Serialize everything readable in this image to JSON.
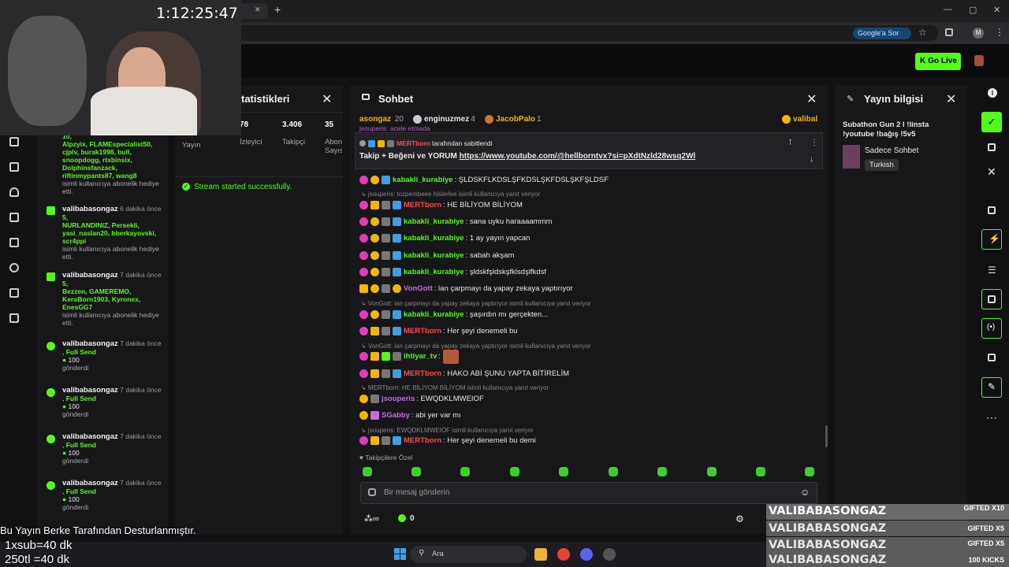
{
  "browser": {
    "tab_title": "ıl Bot",
    "new_tab": "+",
    "google_pill": "Google'a Sor",
    "avatar_letter": "M"
  },
  "timer": "1:12:25:47",
  "header": {
    "go_live": "Go Live"
  },
  "feed": [
    {
      "top_text": "10,",
      "names": "Alpzyix, FLAMEspecialist50, cjplv, burak1998, bull, snoopdogg, rtxbinsix, Dolphinsfanzack, riftinmypants87, wang8",
      "tail": "isimli kullanıcıya abonelik hediye etti."
    },
    {
      "user": "valibabasongaz",
      "time": "6 dakika önce",
      "count": "5,",
      "names": "NURLANDINIZ, Persekli, yasi_naslan20, bberkayovski, scr4ppi",
      "tail": "isimli kullanıcıya abonelik hediye etti."
    },
    {
      "user": "valibabasongaz",
      "time": "7 dakika önce",
      "count": "5,",
      "names": "Bezzen, GAMEREMO, KeroBorn1903, Kyronex, EnesGG7",
      "tail": "isimli kullanıcıya abonelik hediye etti."
    },
    {
      "user": "valibabasongaz",
      "time": "7 dakika önce",
      "sub": "Full Send",
      "amount": "100",
      "sent": "gönderdi"
    },
    {
      "user": "valibabasongaz",
      "time": "7 dakika önce",
      "sub": "Full Send",
      "amount": "100",
      "sent": "gönderdi"
    },
    {
      "user": "valibabasongaz",
      "time": "7 dakika önce",
      "sub": "Full Send",
      "amount": "100",
      "sent": "gönderdi"
    },
    {
      "user": "valibabasongaz",
      "time": "7 dakika önce",
      "sub": "Full Send",
      "amount": "100",
      "sent": "gönderdi"
    }
  ],
  "stats": {
    "title": "tatistikleri",
    "cols": [
      {
        "value": "",
        "label": "Yayın"
      },
      {
        "value": "78",
        "label": "İzleyici"
      },
      {
        "value": "3.406",
        "label": "Takipçi"
      },
      {
        "value": "35",
        "label": "Abon Sayıs"
      }
    ],
    "success": "Stream started successfully."
  },
  "chat": {
    "title": "Sohbet",
    "top_gifters": [
      {
        "name": "asongaz",
        "count": "20"
      },
      {
        "rank": "2",
        "name": "enginuzmez",
        "count": "4"
      },
      {
        "rank": "3",
        "name": "JacobPalo",
        "count": "1"
      },
      {
        "rank": "1",
        "name": "valibal"
      }
    ],
    "partial_line": "jsouperis: acele etmada",
    "pinned_by": "MERTborn",
    "pinned_label": "tarafından sabitlendi",
    "pinned_text": "Takip + Beğeni ve YORUM ",
    "pinned_link": "https://www.youtube.com/@hellborntvx?si=pXdtNzld28wsq2Wl",
    "messages": [
      {
        "user": "kabakli_kurabiye",
        "color": "#53fc18",
        "text": ": ŞLDSKFLKDSLŞFKDSLŞKFDSLŞKFŞLDSF",
        "badges": [
          "b-pink",
          "b-gold",
          "b-blue"
        ]
      },
      {
        "reply": "jsouperis: tozpembeee hislerlee isimli kullanıcıya yanıt veriyor"
      },
      {
        "user": "MERTborn",
        "color": "#ff4b4b",
        "text": ": HE BİLİYOM BİLİYOM",
        "badges": [
          "b-pink",
          "b-crown",
          "b-grey",
          "b-blue"
        ]
      },
      {
        "user": "kabakli_kurabiye",
        "color": "#53fc18",
        "text": ": sana uyku haraaaammm",
        "badges": [
          "b-pink",
          "b-gold",
          "b-grey",
          "b-blue"
        ]
      },
      {
        "user": "kabakli_kurabiye",
        "color": "#53fc18",
        "text": ": 1 ay yayın yapcan",
        "badges": [
          "b-pink",
          "b-gold",
          "b-grey",
          "b-blue"
        ]
      },
      {
        "user": "kabakli_kurabiye",
        "color": "#53fc18",
        "text": ": sabah akşam",
        "badges": [
          "b-pink",
          "b-gold",
          "b-grey",
          "b-blue"
        ]
      },
      {
        "user": "kabakli_kurabiye",
        "color": "#53fc18",
        "text": ": şldskfşldskşfklsdşlfkdsf",
        "badges": [
          "b-pink",
          "b-gold",
          "b-grey",
          "b-blue"
        ]
      },
      {
        "user": "VonGott",
        "color": "#c66be0",
        "text": ": lan çarpmayı da yapay zekaya yaptırıyor",
        "badges": [
          "b-crown",
          "b-gold",
          "b-grey",
          "b-gold"
        ]
      },
      {
        "reply": "VonGott: lan çarpmayı da yapay zekaya yaptırıyor isimli kullanıcıya yanıt veriyor"
      },
      {
        "user": "kabakli_kurabiye",
        "color": "#53fc18",
        "text": ": şaşırdın mı gerçekten...",
        "badges": [
          "b-pink",
          "b-gold",
          "b-grey",
          "b-blue"
        ]
      },
      {
        "user": "MERTborn",
        "color": "#ff4b4b",
        "text": ": Her şeyi denemeli bu",
        "badges": [
          "b-pink",
          "b-crown",
          "b-grey",
          "b-blue"
        ]
      },
      {
        "reply": "VonGott: lan çarpmayı da yapay zekaya yaptırıyor isimli kullanıcıya yanıt veriyor"
      },
      {
        "user": "ihtiyar_tv",
        "color": "#53fc18",
        "text": ":",
        "badges": [
          "b-pink",
          "b-crown",
          "b-green",
          "b-grey"
        ]
      },
      {
        "user": "MERTborn",
        "color": "#ff4b4b",
        "text": ": HAKO ABİ ŞUNU YAPTA BİTİRELİM",
        "badges": [
          "b-pink",
          "b-crown",
          "b-grey",
          "b-blue"
        ]
      },
      {
        "reply": "MERTborn: HE BİLİYOM BİLİYOM isimli kullanıcıya yanıt veriyor"
      },
      {
        "user": "jsouperis",
        "color": "#c66be0",
        "text": ": EWQDKLMWEIOF",
        "badges": [
          "b-gold",
          "b-grey"
        ]
      },
      {
        "user": "SGabby",
        "color": "#c66be0",
        "text": ": abi yer var mı",
        "badges": [
          "b-gold",
          "b-purple"
        ]
      },
      {
        "reply": "jsouperis: EWQDKLMWEIOF isimli kullanıcıya yanıt veriyor"
      },
      {
        "user": "MERTborn",
        "color": "#ff4b4b",
        "text": ": Her şeyi denemeli bu demi",
        "badges": [
          "b-pink",
          "b-crown",
          "b-grey",
          "b-blue"
        ]
      }
    ],
    "followers_only": "Takipçilere Özel",
    "input_placeholder": "Bir mesaj gönderin",
    "kicks_count": "0"
  },
  "info": {
    "title": "Yayın bilgisi",
    "stream_title": "Subathon Gun 2 l !linsta !youtube !bağış !5v5",
    "category": "Sadece Sohbet",
    "language": "Turkish"
  },
  "taskbar": {
    "search": "Ara"
  },
  "overlay": {
    "line1": "Bu Yayın Berke Tarafından Desturlanmıştır.",
    "line2": "1xsub=40 dk",
    "line3": "250tl =40 dk"
  },
  "gifts": [
    {
      "name": "VALIBABASONGAZ",
      "tag": "GIFTED X10"
    },
    {
      "name": "VALIBABASONGAZ",
      "tag": "GIFTED X5"
    },
    {
      "name": "VALIBABASONGAZ",
      "tag": "GIFTED X5"
    },
    {
      "name": "VALIBABASONGAZ",
      "tag": "100 KICKS"
    }
  ],
  "colors": {
    "accent": "#53fc18",
    "panel": "#17171a",
    "background": "#111114"
  }
}
